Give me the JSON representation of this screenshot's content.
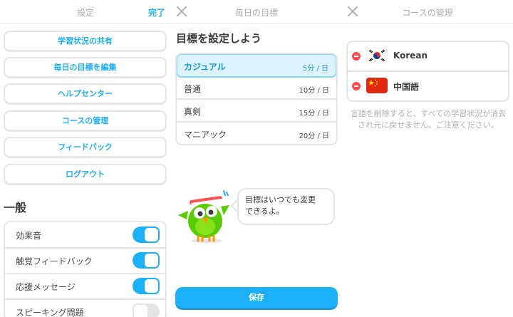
{
  "settings_panel": {
    "title": "設定",
    "done_label": "完了",
    "menu": [
      {
        "label": "学習状況の共有"
      },
      {
        "label": "毎日の目標を編集"
      },
      {
        "label": "ヘルプセンター"
      },
      {
        "label": "コースの管理"
      },
      {
        "label": "フィードバック"
      },
      {
        "label": "ログアウト"
      }
    ],
    "section_title": "一般",
    "toggles": [
      {
        "label": "効果音",
        "on": true
      },
      {
        "label": "触覚フィードバック",
        "on": true
      },
      {
        "label": "応援メッセージ",
        "on": true
      },
      {
        "label": "スピーキング問題",
        "on": false
      }
    ]
  },
  "goal_panel": {
    "title": "毎日の目標",
    "heading": "目標を設定しよう",
    "goals": [
      {
        "name": "カジュアル",
        "value": "5分 / 日",
        "selected": true
      },
      {
        "name": "普通",
        "value": "10分 / 日",
        "selected": false
      },
      {
        "name": "真剣",
        "value": "15分 / 日",
        "selected": false
      },
      {
        "name": "マニアック",
        "value": "20分 / 日",
        "selected": false
      }
    ],
    "bubble_line1": "目標はいつでも変更",
    "bubble_line2": "できるよ。",
    "save_label": "保存"
  },
  "course_panel": {
    "title": "コースの管理",
    "courses": [
      {
        "name": "Korean",
        "flag_icon": "south-korea-flag-icon"
      },
      {
        "name": "中国語",
        "flag_icon": "china-flag-icon"
      }
    ],
    "note": "言語を削除すると、すべての学習状況が消去され元に戻せません。ご注意ください。"
  },
  "colors": {
    "accent": "#1cb0f6",
    "accent_dark": "#1899d6",
    "selected_bg": "#ddf4ff",
    "border": "#e5e5e5",
    "danger": "#ff4b4b",
    "owl_green": "#58cc02"
  }
}
